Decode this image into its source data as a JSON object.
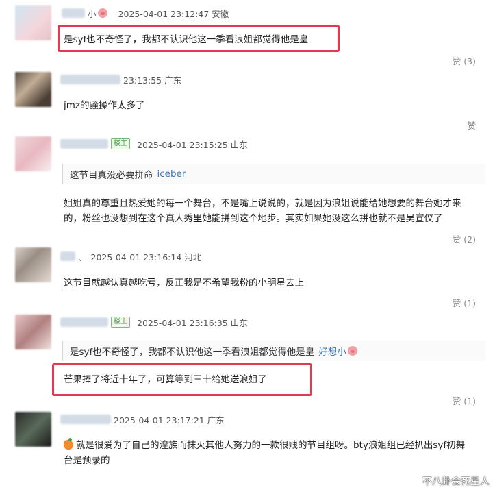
{
  "comments": [
    {
      "name_tail": "小",
      "time": "2025-04-01 23:12:47 安徽",
      "text": "是syf也不奇怪了，我都不认识他这一季看浪姐都觉得他是皇",
      "likes": "赞 (3)"
    },
    {
      "name_tail": "",
      "time": "23:13:55 广东",
      "text": "jmz的骚操作太多了",
      "likes": "赞"
    },
    {
      "name_tail": "",
      "badge": "楼主",
      "time": "2025-04-01 23:15:25 山东",
      "quote_text": "这节目真没必要拼命",
      "quote_name": "iceber",
      "text_line1": "姐姐真的尊重且热爱她的每一个舞台，不是嘴上说说的，就是因为浪姐说能给她想要的舞台她才来",
      "text_line2": "的，粉丝也没想到在这个真人秀里她能拼到这个地步。其实如果她没这么拼也就不是吴宣仪了",
      "likes": "赞 (2)"
    },
    {
      "name_tail": "、",
      "time": "2025-04-01 23:16:14 河北",
      "text": "这节目就越认真越吃亏，反正我是不希望我粉的小明星去上",
      "likes": "赞 (1)"
    },
    {
      "name_tail": "",
      "badge": "楼主",
      "time": "2025-04-01 23:16:35 山东",
      "quote_text": "是syf也不奇怪了，我都不认识他这一季看浪姐都觉得他是皇",
      "quote_name": "好想小",
      "text": "芒果捧了将近十年了，可算等到三十给她送浪姐了",
      "likes": "赞 (1)"
    },
    {
      "name_tail": "",
      "time": "2025-04-01 23:17:21 广东",
      "text_line1": "就是很爱为了自己的湟族而抹灭其他人努力的一款很贱的节目组呀。bty浪姐组已经扒出syf初舞",
      "text_line2": "台是预录的"
    }
  ],
  "watermark": "不八卦会死星人",
  "colors": {
    "highlight_border": "#e03a52",
    "link_blue": "#3b78c2",
    "badge_green": "#4a9a4a"
  },
  "icons": [
    "pig-emoji-icon",
    "carrot-emoji-icon"
  ]
}
